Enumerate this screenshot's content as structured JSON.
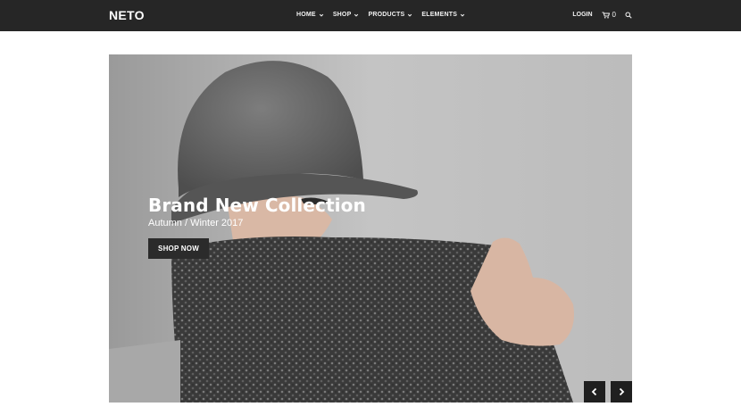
{
  "brand": "NETO",
  "nav": {
    "items": [
      {
        "label": "HOME"
      },
      {
        "label": "SHOP"
      },
      {
        "label": "PRODUCTS"
      },
      {
        "label": "ELEMENTS"
      }
    ],
    "login": "LOGIN",
    "cart_count": "0"
  },
  "hero": {
    "title": "Brand New Collection",
    "subtitle": "Autumn / Winter 2017",
    "cta": "SHOP NOW"
  },
  "colors": {
    "navbar": "#262626",
    "button": "#2b2b2b",
    "hero_bg": "#bdbdbd"
  },
  "icons": [
    "cart-icon",
    "search-icon",
    "chevron-down-icon",
    "chevron-left-icon",
    "chevron-right-icon"
  ]
}
